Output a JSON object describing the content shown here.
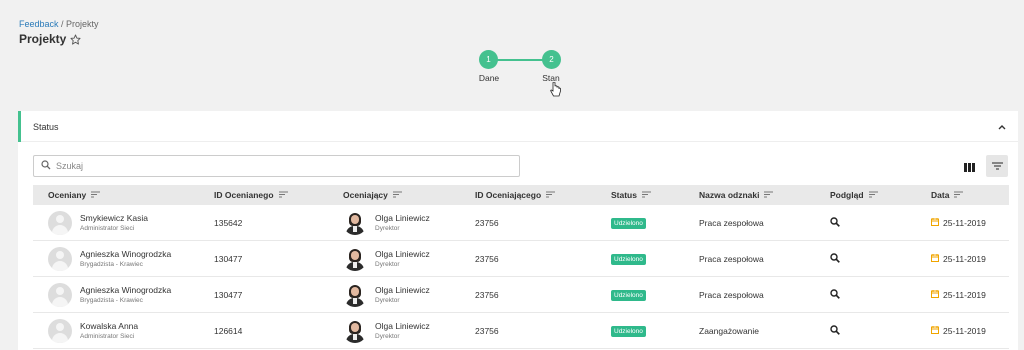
{
  "breadcrumb": {
    "link": "Feedback",
    "separator": " / ",
    "current": "Projekty"
  },
  "page": {
    "title": "Projekty"
  },
  "stepper": {
    "steps": [
      {
        "number": "1",
        "label": "Dane"
      },
      {
        "number": "2",
        "label": "Stan"
      }
    ]
  },
  "panel": {
    "title": "Status"
  },
  "search": {
    "placeholder": "Szukaj",
    "value": ""
  },
  "table": {
    "columns": [
      "Oceniany",
      "ID Ocenianego",
      "Oceniający",
      "ID Oceniającego",
      "Status",
      "Nazwa odznaki",
      "Podgląd",
      "Data"
    ],
    "rows": [
      {
        "rated": "Smykiewicz Kasia",
        "rated_role": "Administrator Sieci",
        "rated_id": "135642",
        "rater": "Olga Liniewicz",
        "rater_role": "Dyrektor",
        "rater_id": "23756",
        "status": "Udzielono",
        "badge": "Praca zespołowa",
        "date": "25-11-2019"
      },
      {
        "rated": "Agnieszka Winogrodzka",
        "rated_role": "Brygadzista - Krawiec",
        "rated_id": "130477",
        "rater": "Olga Liniewicz",
        "rater_role": "Dyrektor",
        "rater_id": "23756",
        "status": "Udzielono",
        "badge": "Praca zespołowa",
        "date": "25-11-2019"
      },
      {
        "rated": "Agnieszka Winogrodzka",
        "rated_role": "Brygadzista - Krawiec",
        "rated_id": "130477",
        "rater": "Olga Liniewicz",
        "rater_role": "Dyrektor",
        "rater_id": "23756",
        "status": "Udzielono",
        "badge": "Praca zespołowa",
        "date": "25-11-2019"
      },
      {
        "rated": "Kowalska Anna",
        "rated_role": "Administrator Sieci",
        "rated_id": "126614",
        "rater": "Olga Liniewicz",
        "rater_role": "Dyrektor",
        "rater_id": "23756",
        "status": "Udzielono",
        "badge": "Zaangażowanie",
        "date": "25-11-2019"
      }
    ]
  },
  "colors": {
    "accent": "#44c18f",
    "badge": "#2fb98b",
    "link": "#2b7bb9",
    "calendar": "#f0a500"
  },
  "icons": {
    "favorite": "star-outline-icon",
    "collapse": "chevron-up-icon",
    "search": "search-icon",
    "columns": "columns-icon",
    "filter": "filter-icon",
    "sort": "sort-icon",
    "preview": "magnifier-icon",
    "date": "calendar-icon"
  }
}
